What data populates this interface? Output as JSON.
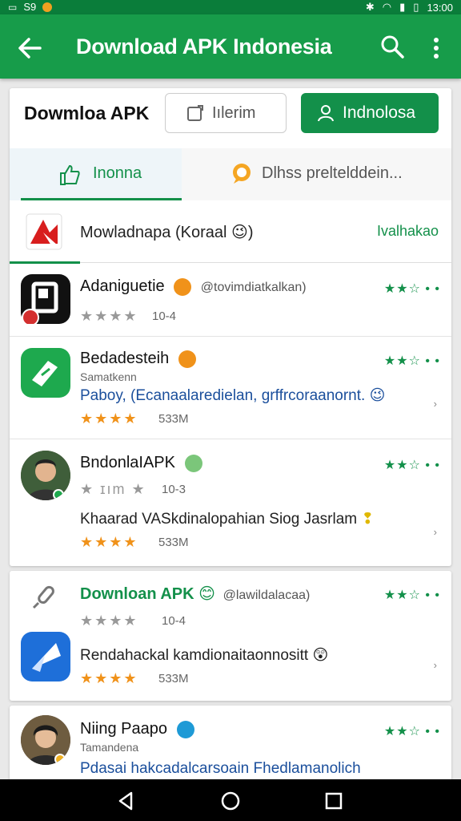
{
  "status": {
    "left": "S9",
    "time": "13:00"
  },
  "appbar": {
    "title": "Download APK Indonesia"
  },
  "header": {
    "title": "Dowmloa APK",
    "outline_button": "Iılerim",
    "green_button": "Indnolosa"
  },
  "tabs": [
    {
      "label": "Inonna"
    },
    {
      "label": "Dlhss preltelddein..."
    }
  ],
  "featured": {
    "name": "Mowladnapa (Koraal 😉)",
    "action": "Ivalhakao"
  },
  "items": [
    {
      "name": "Adaniguetie",
      "handle": "@tovimdiatkalkan)",
      "stars_text": "★★★★",
      "meta": "10-4",
      "rating": "★★☆ • •"
    },
    {
      "name": "Bedadesteih",
      "sub": "Samatkenn",
      "desc": "Paboy, (Ecanaalaredielan, grffrcoraanornt.",
      "stars_text": "★★★★",
      "meta": "533M",
      "rating": "★★☆ • •",
      "chev": "›"
    },
    {
      "name": "BndonlaIAPK",
      "stars_text": "★ ɪım ★",
      "meta": "10-3",
      "desc": "Khaarad VASkdinalopahian Siog Jasrlam",
      "stars2": "★★★★",
      "meta2": "533M",
      "rating": "★★☆ • •",
      "chev": "›"
    },
    {
      "name": "Downloan APK",
      "handle": "@lawildalacaa)",
      "stars_text": "★★★★",
      "meta": "10-4",
      "desc": "Rendahackal kamdionaitaonnositt",
      "stars2": "★★★★",
      "meta2": "533M",
      "rating": "★★☆ • •",
      "chev": "›"
    },
    {
      "name": "Niing Paapo",
      "sub": "Tamandena",
      "desc": "Pdasai hakcadalcarsoain Fhedlamanolich",
      "rating": "★★☆ • •"
    }
  ],
  "colors": {
    "primary": "#179c4a",
    "accent": "#13904a",
    "star": "#f0921a",
    "link": "#1b4f9c"
  }
}
